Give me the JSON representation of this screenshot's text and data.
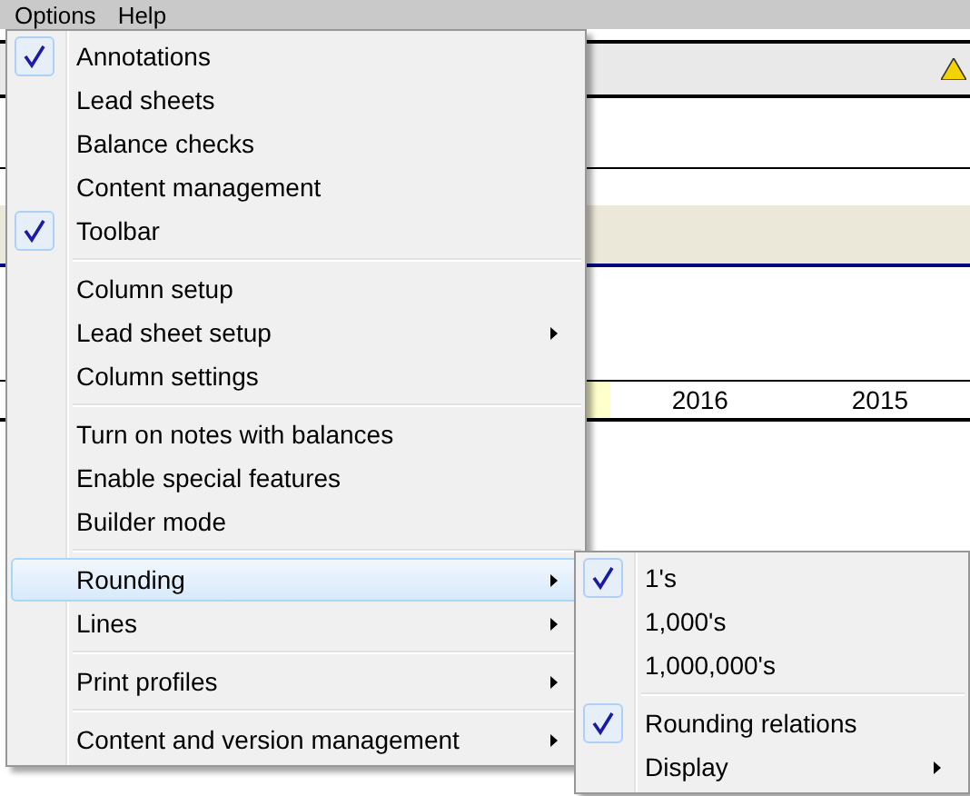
{
  "menubar": [
    {
      "label": "Options"
    },
    {
      "label": "Help"
    }
  ],
  "background": {
    "year_columns": [
      "2016",
      "2015"
    ]
  },
  "options_menu": {
    "groups": [
      {
        "items": [
          {
            "label": "Annotations",
            "checked": true,
            "submenu": false,
            "selected": false
          },
          {
            "label": "Lead sheets",
            "checked": false,
            "submenu": false,
            "selected": false
          },
          {
            "label": "Balance checks",
            "checked": false,
            "submenu": false,
            "selected": false
          },
          {
            "label": "Content management",
            "checked": false,
            "submenu": false,
            "selected": false
          },
          {
            "label": "Toolbar",
            "checked": true,
            "submenu": false,
            "selected": false
          }
        ]
      },
      {
        "items": [
          {
            "label": "Column setup",
            "checked": false,
            "submenu": false,
            "selected": false
          },
          {
            "label": "Lead sheet setup",
            "checked": false,
            "submenu": true,
            "selected": false
          },
          {
            "label": "Column settings",
            "checked": false,
            "submenu": false,
            "selected": false
          }
        ]
      },
      {
        "items": [
          {
            "label": "Turn on notes with balances",
            "checked": false,
            "submenu": false,
            "selected": false
          },
          {
            "label": "Enable special features",
            "checked": false,
            "submenu": false,
            "selected": false
          },
          {
            "label": "Builder mode",
            "checked": false,
            "submenu": false,
            "selected": false
          }
        ]
      },
      {
        "items": [
          {
            "label": "Rounding",
            "checked": false,
            "submenu": true,
            "selected": true
          },
          {
            "label": "Lines",
            "checked": false,
            "submenu": true,
            "selected": false
          }
        ]
      },
      {
        "items": [
          {
            "label": "Print profiles",
            "checked": false,
            "submenu": true,
            "selected": false
          }
        ]
      },
      {
        "items": [
          {
            "label": "Content and version management",
            "checked": false,
            "submenu": true,
            "selected": false
          }
        ]
      }
    ]
  },
  "rounding_submenu": {
    "groups": [
      {
        "items": [
          {
            "label": "1's",
            "checked": true,
            "submenu": false,
            "selected": false
          },
          {
            "label": "1,000's",
            "checked": false,
            "submenu": false,
            "selected": false
          },
          {
            "label": "1,000,000's",
            "checked": false,
            "submenu": false,
            "selected": false
          }
        ]
      },
      {
        "items": [
          {
            "label": "Rounding relations",
            "checked": true,
            "submenu": false,
            "selected": false
          },
          {
            "label": "Display",
            "checked": false,
            "submenu": true,
            "selected": false
          }
        ]
      }
    ]
  }
}
